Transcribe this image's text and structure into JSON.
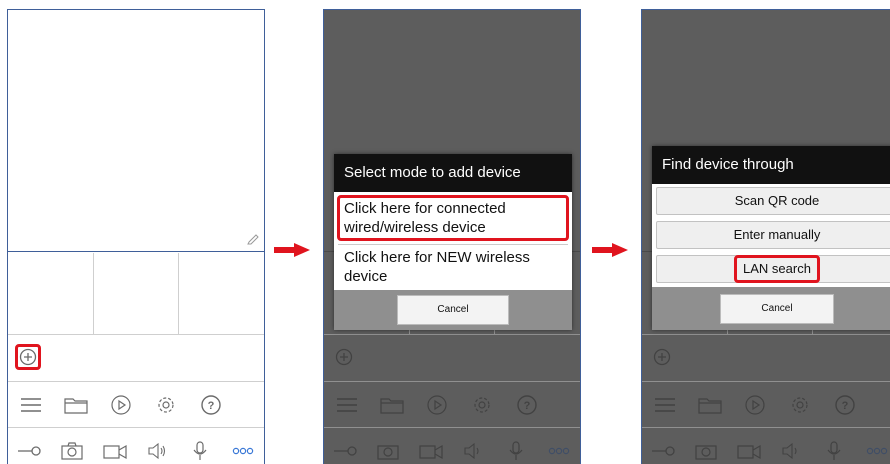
{
  "step1": {
    "icons": {
      "add": "add-circle-icon",
      "row1": [
        "list-icon",
        "folder-icon",
        "playback-icon",
        "settings-icon",
        "help-icon"
      ],
      "row2": [
        "key-icon",
        "camera-icon",
        "record-icon",
        "speaker-icon",
        "microphone-icon",
        "more-icon"
      ]
    }
  },
  "step2": {
    "dialog_title": "Select mode to add device",
    "option_connected_line1": "Click here for connected",
    "option_connected_line2": "wired/wireless device",
    "option_new_line1": "Click here for NEW wireless",
    "option_new_line2": "device",
    "cancel_label": "Cancel"
  },
  "step3": {
    "dialog_title": "Find device through",
    "scan_qr_label": "Scan QR code",
    "enter_manually_label": "Enter manually",
    "lan_search_label": "LAN search",
    "cancel_label": "Cancel"
  },
  "colors": {
    "highlight": "#e0141e",
    "icon": "#6b6b6b",
    "more_icon": "#3a78d6",
    "frame": "#3f5f99"
  }
}
